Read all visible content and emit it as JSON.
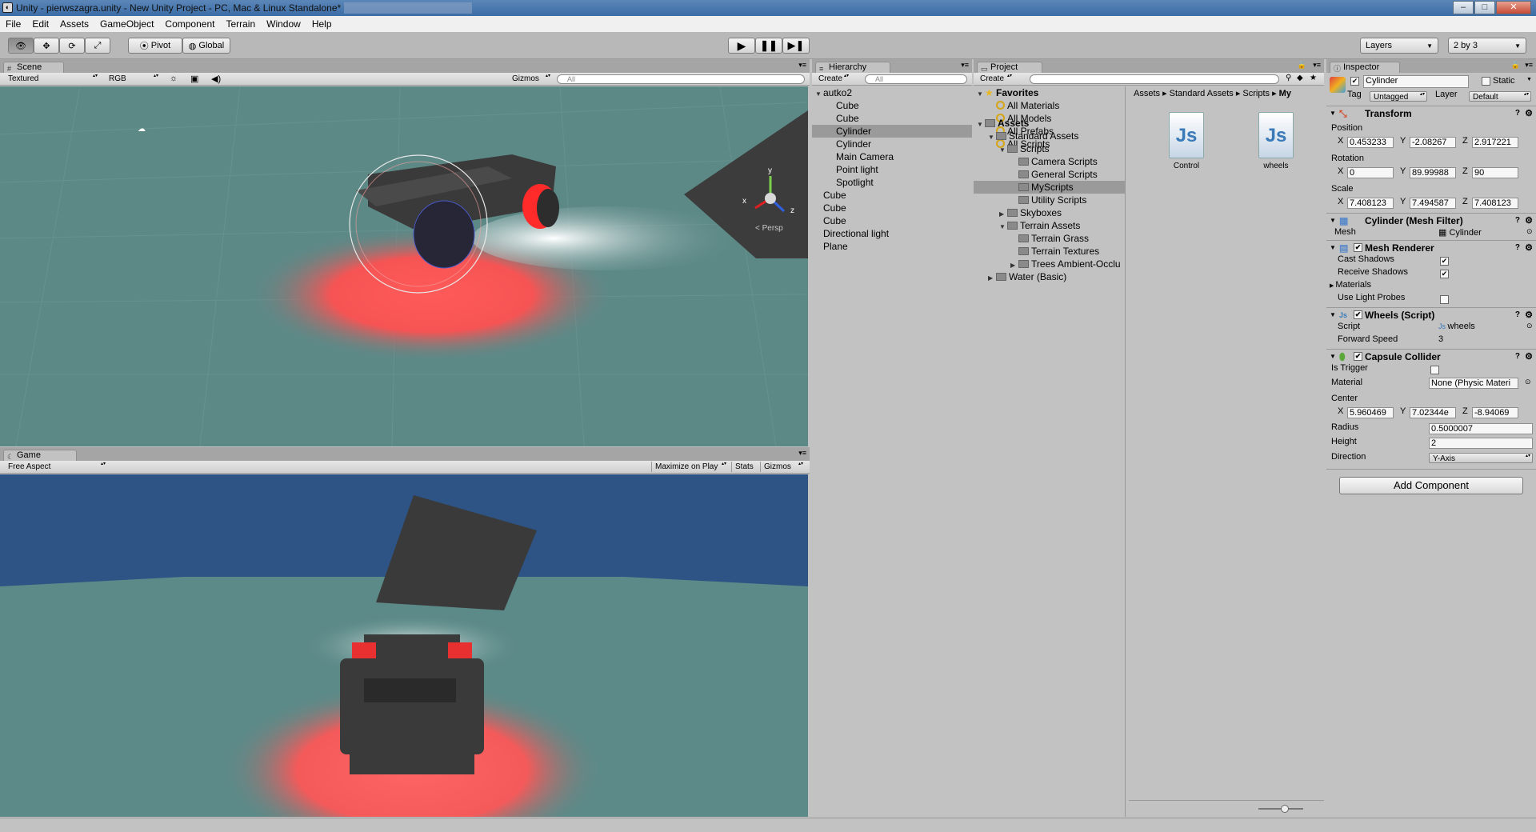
{
  "window": {
    "title": "Unity - pierwszagra.unity - New Unity Project - PC, Mac & Linux Standalone*",
    "minimize": "–",
    "maximize": "□",
    "close": "✕"
  },
  "menu": [
    "File",
    "Edit",
    "Assets",
    "GameObject",
    "Component",
    "Terrain",
    "Window",
    "Help"
  ],
  "toolbar": {
    "pivot": "Pivot",
    "global": "Global",
    "layers": "Layers",
    "layout": "2 by 3"
  },
  "scene": {
    "tab": "Scene",
    "render_mode": "Textured",
    "color_mode": "RGB",
    "gizmos": "Gizmos",
    "search": "All",
    "persp": "Persp",
    "axis_y": "y",
    "axis_x": "x",
    "axis_z": "z"
  },
  "game": {
    "tab": "Game",
    "aspect": "Free Aspect",
    "maximize": "Maximize on Play",
    "stats": "Stats",
    "gizmos": "Gizmos"
  },
  "hierarchy": {
    "tab": "Hierarchy",
    "create": "Create",
    "search": "All",
    "items": [
      {
        "label": "autko2",
        "level": 0,
        "arrow": "▼"
      },
      {
        "label": "Cube",
        "level": 1
      },
      {
        "label": "Cube",
        "level": 1
      },
      {
        "label": "Cylinder",
        "level": 1,
        "selected": true
      },
      {
        "label": "Cylinder",
        "level": 1
      },
      {
        "label": "Main Camera",
        "level": 1
      },
      {
        "label": "Point light",
        "level": 1
      },
      {
        "label": "Spotlight",
        "level": 1
      },
      {
        "label": "Cube",
        "level": 0
      },
      {
        "label": "Cube",
        "level": 0
      },
      {
        "label": "Cube",
        "level": 0
      },
      {
        "label": "Directional light",
        "level": 0
      },
      {
        "label": "Plane",
        "level": 0
      }
    ]
  },
  "project": {
    "tab": "Project",
    "create": "Create",
    "favorites": {
      "label": "Favorites",
      "items": [
        "All Materials",
        "All Models",
        "All Prefabs",
        "All Scripts"
      ]
    },
    "assets": {
      "label": "Assets",
      "items": [
        {
          "label": "Standard Assets",
          "level": 1,
          "arrow": "▼"
        },
        {
          "label": "Scripts",
          "level": 2,
          "arrow": "▼"
        },
        {
          "label": "Camera Scripts",
          "level": 3
        },
        {
          "label": "General Scripts",
          "level": 3
        },
        {
          "label": "MyScripts",
          "level": 3,
          "selected": true
        },
        {
          "label": "Utility Scripts",
          "level": 3
        },
        {
          "label": "Skyboxes",
          "level": 2,
          "arrow": "▶"
        },
        {
          "label": "Terrain Assets",
          "level": 2,
          "arrow": "▼"
        },
        {
          "label": "Terrain Grass",
          "level": 3
        },
        {
          "label": "Terrain Textures",
          "level": 3
        },
        {
          "label": "Trees Ambient-Occlu",
          "level": 3,
          "arrow": "▶"
        },
        {
          "label": "Water (Basic)",
          "level": 1,
          "arrow": "▶"
        }
      ]
    },
    "breadcrumb": [
      "Assets",
      "Standard Assets",
      "Scripts",
      "My"
    ],
    "files": [
      {
        "name": "Control",
        "icon": "Js"
      },
      {
        "name": "wheels",
        "icon": "Js"
      }
    ]
  },
  "inspector": {
    "tab": "Inspector",
    "name": "Cylinder",
    "static": "Static",
    "tag_label": "Tag",
    "tag": "Untagged",
    "layer_label": "Layer",
    "layer": "Default",
    "transform": {
      "title": "Transform",
      "position_label": "Position",
      "position": [
        "0.453233",
        "-2.08267",
        "2.917221"
      ],
      "rotation_label": "Rotation",
      "rotation": [
        "0",
        "89.99988",
        "90"
      ],
      "scale_label": "Scale",
      "scale": [
        "7.408123",
        "7.494587",
        "7.408123"
      ]
    },
    "xyz": [
      "X",
      "Y",
      "Z"
    ],
    "mesh_filter": {
      "title": "Cylinder (Mesh Filter)",
      "mesh_label": "Mesh",
      "mesh": "Cylinder"
    },
    "mesh_renderer": {
      "title": "Mesh Renderer",
      "cast": "Cast Shadows",
      "receive": "Receive Shadows",
      "materials": "Materials",
      "probes": "Use Light Probes"
    },
    "wheels": {
      "title": "Wheels (Script)",
      "script_label": "Script",
      "script": "wheels",
      "speed_label": "Forward Speed",
      "speed": "3"
    },
    "capsule": {
      "title": "Capsule Collider",
      "trigger": "Is Trigger",
      "material_label": "Material",
      "material": "None (Physic Materi",
      "center_label": "Center",
      "center": [
        "5.960469",
        "7.02344e",
        "-8.94069"
      ],
      "radius_label": "Radius",
      "radius": "0.5000007",
      "height_label": "Height",
      "height": "2",
      "direction_label": "Direction",
      "direction": "Y-Axis"
    },
    "add_component": "Add Component"
  }
}
